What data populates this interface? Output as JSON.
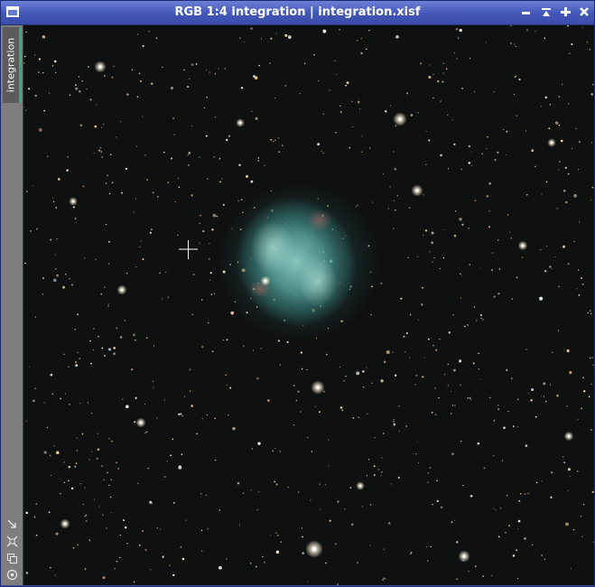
{
  "window": {
    "title": "RGB 1:4 integration | integration.xisf",
    "buttons": {
      "minimize": "minimize-icon",
      "shade": "shade-icon",
      "maximize": "maximize-icon",
      "close": "close-icon"
    }
  },
  "sidebar": {
    "view_tab_label": "integration",
    "tools": [
      "fit-view-icon",
      "zoom-to-fit-icon",
      "clone-view-icon",
      "preview-icon"
    ]
  },
  "image": {
    "subject": "planetary-nebula",
    "cursor": "crosshair-icon",
    "colors": {
      "sky": "#0f1110",
      "nebula_core": "#8ed0c6",
      "nebula_edge": "#3e8f8c",
      "nebula_rim": "#b46a66",
      "accent_tab": "#2fb07a"
    }
  }
}
